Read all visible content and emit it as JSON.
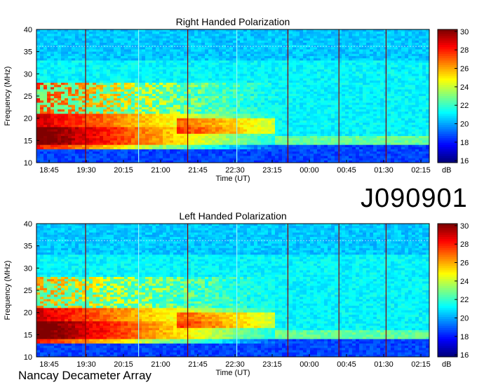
{
  "target_id": "J090901",
  "instrument": "Nancay Decameter Array",
  "chart_data": [
    {
      "type": "heatmap",
      "title": "Right Handed Polarization",
      "xlabel": "Time (UT)",
      "ylabel": "Frequency (MHz)",
      "x_ticks": [
        "18:45",
        "19:30",
        "20:15",
        "21:00",
        "21:45",
        "22:30",
        "23:15",
        "00:00",
        "00:45",
        "01:30",
        "02:15"
      ],
      "y_ticks": [
        10,
        15,
        20,
        25,
        30,
        35,
        40
      ],
      "ylim": [
        10,
        40
      ],
      "colorbar": {
        "label": "dB",
        "min": 16,
        "max": 30,
        "ticks": [
          16,
          18,
          20,
          22,
          24,
          26,
          28,
          30
        ]
      }
    },
    {
      "type": "heatmap",
      "title": "Left Handed Polarization",
      "xlabel": "Time (UT)",
      "ylabel": "Frequency (MHz)",
      "x_ticks": [
        "18:45",
        "19:30",
        "20:15",
        "21:00",
        "21:45",
        "22:30",
        "23:15",
        "00:00",
        "00:45",
        "01:30",
        "02:15"
      ],
      "y_ticks": [
        10,
        15,
        20,
        25,
        30,
        35,
        40
      ],
      "ylim": [
        10,
        40
      ],
      "colorbar": {
        "label": "dB",
        "min": 16,
        "max": 30,
        "ticks": [
          16,
          18,
          20,
          22,
          24,
          26,
          28,
          30
        ]
      }
    }
  ],
  "colors": {
    "low": "#00008f",
    "mid": "#2a90ff",
    "high": "#8b0000"
  }
}
